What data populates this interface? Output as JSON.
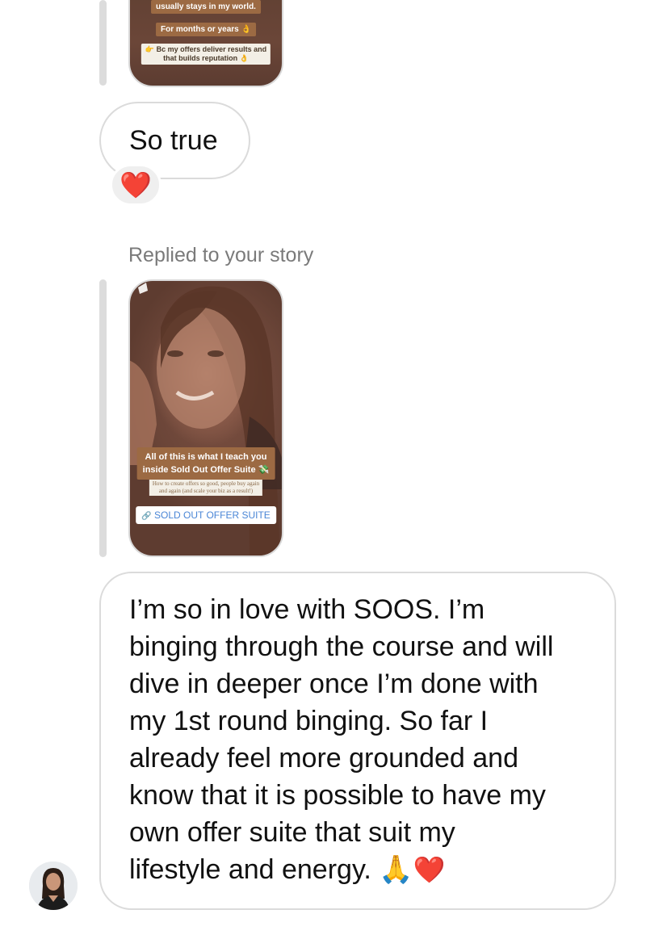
{
  "story_top": {
    "line1": "usually stays in my world.",
    "line2": "For months or years",
    "line2_emoji": "👌",
    "line3a": "Bc my offers deliver results and",
    "line3b": "that builds reputation",
    "line3_emoji": "👌",
    "line3_pointer": "👉"
  },
  "message_so_true": {
    "text": "So true",
    "reaction": "❤️"
  },
  "story_reply": {
    "label": "Replied to your story",
    "teach_line1": "All of this is what I teach you",
    "teach_line2": "inside Sold Out Offer Suite",
    "teach_emoji": "💸",
    "howto_line1": "How to create offers so good, people buy again",
    "howto_line2": "and again (and scale your biz as a result!)",
    "link_label": "SOLD OUT OFFER SUITE",
    "link_icon": "🔗"
  },
  "message_main": {
    "lines": [
      "I’m so in love with SOOS. I’m",
      "binging through the course and will",
      "dive in deeper once I’m done with",
      "my 1st round binging. So far I",
      "already feel more grounded and",
      "know that it is possible to have my",
      "own offer suite that suit my",
      "lifestyle and energy."
    ],
    "emoji_pray": "🙏",
    "emoji_heart": "❤️"
  },
  "colors": {
    "bubble_border": "#dbdbdb",
    "reply_bar": "#dcdcdc",
    "story_tag": "#9c6a43",
    "link_blue": "#4a86d6",
    "reaction_bg": "#efefef"
  }
}
